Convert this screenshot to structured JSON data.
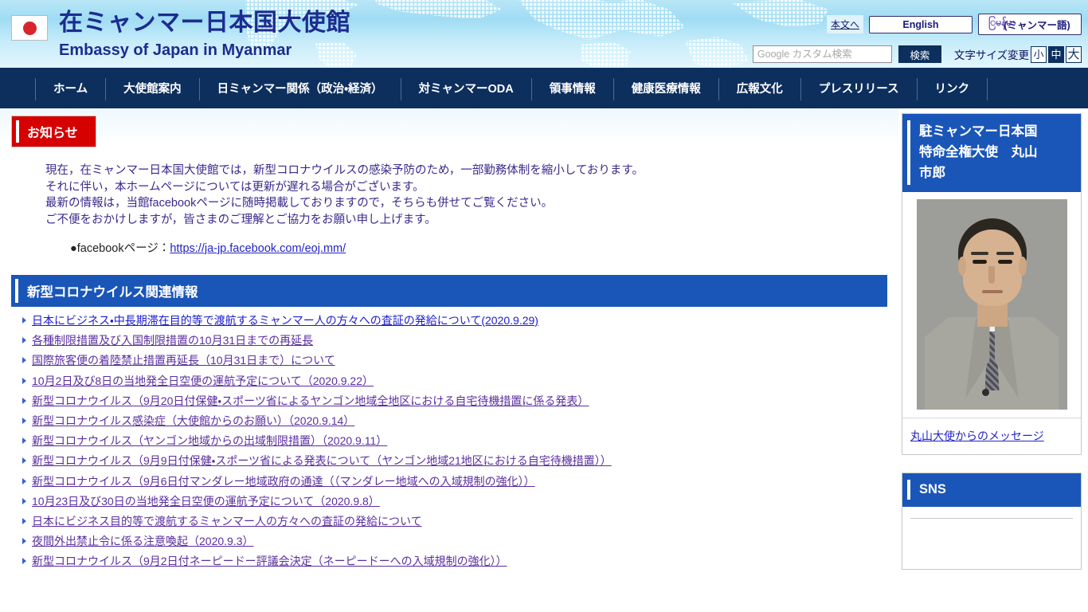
{
  "header": {
    "flag_icon": "japan-flag-icon",
    "title_ja": "在ミャンマー日本国大使館",
    "title_en": "Embassy of Japan in Myanmar",
    "skip_to_content": "本文へ",
    "lang_english": "English",
    "lang_myanmar_native": "ြမန်မာ",
    "lang_myanmar_ja": "(ミャンマー語)",
    "search_placeholder": "Google カスタム検索",
    "search_value": "",
    "search_button": "検索",
    "fontsize_label": "文字サイズ変更",
    "fontsize_small": "小",
    "fontsize_medium": "中",
    "fontsize_large": "大",
    "fontsize_selected": "中"
  },
  "nav": {
    "items": [
      {
        "label": "ホーム"
      },
      {
        "label": "大使館案内"
      },
      {
        "label": "日ミャンマー関係（政治・経済）"
      },
      {
        "label": "対ミャンマーODA"
      },
      {
        "label": "領事情報"
      },
      {
        "label": "健康医療情報"
      },
      {
        "label": "広報文化"
      },
      {
        "label": "プレスリリース"
      },
      {
        "label": "リンク"
      }
    ]
  },
  "notice": {
    "tag": "お知らせ",
    "lines": [
      "現在，在ミャンマー日本国大使館では，新型コロナウイルスの感染予防のため，一部勤務体制を縮小しております。",
      "それに伴い，本ホームページについては更新が遅れる場合がございます。",
      "最新の情報は，当館facebookページに随時掲載しておりますので，そちらも併せてご覧ください。",
      "ご不便をおかけしますが，皆さまのご理解とご協力をお願い申し上げます。"
    ],
    "facebook_label": "●facebookページ：",
    "facebook_url": "https://ja-jp.facebook.com/eoj.mm/"
  },
  "corona_section": {
    "heading": "新型コロナウイルス関連情報",
    "links": [
      {
        "text": "日本にビジネス・中長期滞在目的等で渡航するミャンマー人の方々への査証の発給について(2020.9.29)",
        "visited": false
      },
      {
        "text": "各種制限措置及び入国制限措置の10月31日までの再延長",
        "visited": true
      },
      {
        "text": "国際旅客便の着陸禁止措置再延長（10月31日まで）について",
        "visited": true
      },
      {
        "text": "10月2日及び8日の当地発全日空便の運航予定について（2020.9.22）",
        "visited": true
      },
      {
        "text": "新型コロナウイルス（9月20日付保健・スポーツ省によるヤンゴン地域全地区における自宅待機措置に係る発表）",
        "visited": true
      },
      {
        "text": "新型コロナウイルス感染症（大使館からのお願い）（2020.9.14）",
        "visited": true
      },
      {
        "text": "新型コロナウイルス（ヤンゴン地域からの出域制限措置）（2020.9.11）",
        "visited": true
      },
      {
        "text": "新型コロナウイルス（9月9日付保健・スポーツ省による発表について（ヤンゴン地域21地区における自宅待機措置））",
        "visited": true
      },
      {
        "text": "新型コロナウイルス（9月6日付マンダレー地域政府の通達（（マンダレー地域への入域規制の強化））",
        "visited": true
      },
      {
        "text": "10月23日及び30日の当地発全日空便の運航予定について（2020.9.8）",
        "visited": true
      },
      {
        "text": "日本にビジネス目的等で渡航するミャンマー人の方々への査証の発給について",
        "visited": true
      },
      {
        "text": "夜間外出禁止令に係る注意喚起（2020.9.3）",
        "visited": true
      },
      {
        "text": "新型コロナウイルス（9月2日付ネーピードー評議会決定（ネーピードーへの入域規制の強化））",
        "visited": true
      }
    ]
  },
  "sidebar": {
    "ambassador": {
      "heading": "駐ミャンマー日本国\n特命全権大使　丸山\n市郎",
      "heading_line1": "駐ミャンマー日本国",
      "heading_line2": "特命全権大使　丸山",
      "heading_line3": "市郎",
      "photo_alt": "丸山市郎大使 写真",
      "message_link": "丸山大使からのメッセージ"
    },
    "sns": {
      "heading": "SNS"
    }
  },
  "colors": {
    "navy": "#0d2f5e",
    "blue_section": "#1a56b8",
    "red_notice": "#d60000",
    "link_fresh": "#1b1bd0",
    "link_visited": "#5b2f9e",
    "header_gradient_top": "#b9e6f7"
  }
}
